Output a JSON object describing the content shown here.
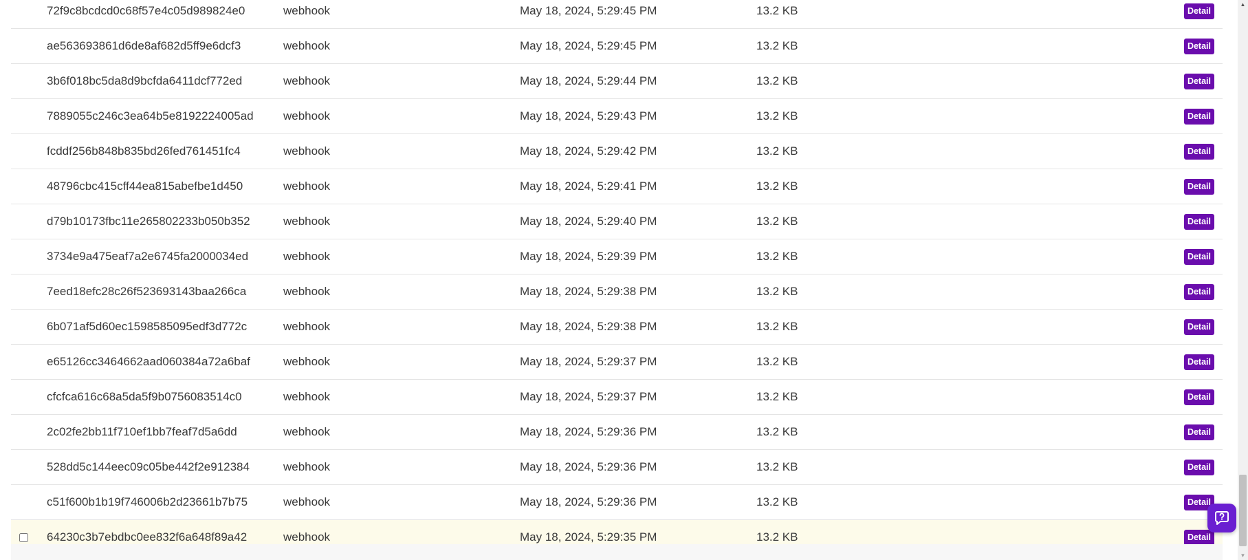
{
  "table": {
    "detail_label": "Detail",
    "rows": [
      {
        "id": "72f9c8bcdcd0c68f57e4c05d989824e0",
        "type": "webhook",
        "date": "May 18, 2024, 5:29:45 PM",
        "size": "13.2 KB"
      },
      {
        "id": "ae563693861d6de8af682d5ff9e6dcf3",
        "type": "webhook",
        "date": "May 18, 2024, 5:29:45 PM",
        "size": "13.2 KB"
      },
      {
        "id": "3b6f018bc5da8d9bcfda6411dcf772ed",
        "type": "webhook",
        "date": "May 18, 2024, 5:29:44 PM",
        "size": "13.2 KB"
      },
      {
        "id": "7889055c246c3ea64b5e8192224005ad",
        "type": "webhook",
        "date": "May 18, 2024, 5:29:43 PM",
        "size": "13.2 KB"
      },
      {
        "id": "fcddf256b848b835bd26fed761451fc4",
        "type": "webhook",
        "date": "May 18, 2024, 5:29:42 PM",
        "size": "13.2 KB"
      },
      {
        "id": "48796cbc415cff44ea815abefbe1d450",
        "type": "webhook",
        "date": "May 18, 2024, 5:29:41 PM",
        "size": "13.2 KB"
      },
      {
        "id": "d79b10173fbc11e265802233b050b352",
        "type": "webhook",
        "date": "May 18, 2024, 5:29:40 PM",
        "size": "13.2 KB"
      },
      {
        "id": "3734e9a475eaf7a2e6745fa2000034ed",
        "type": "webhook",
        "date": "May 18, 2024, 5:29:39 PM",
        "size": "13.2 KB"
      },
      {
        "id": "7eed18efc28c26f523693143baa266ca",
        "type": "webhook",
        "date": "May 18, 2024, 5:29:38 PM",
        "size": "13.2 KB"
      },
      {
        "id": "6b071af5d60ec1598585095edf3d772c",
        "type": "webhook",
        "date": "May 18, 2024, 5:29:38 PM",
        "size": "13.2 KB"
      },
      {
        "id": "e65126cc3464662aad060384a72a6baf",
        "type": "webhook",
        "date": "May 18, 2024, 5:29:37 PM",
        "size": "13.2 KB"
      },
      {
        "id": "cfcfca616c68a5da5f9b0756083514c0",
        "type": "webhook",
        "date": "May 18, 2024, 5:29:37 PM",
        "size": "13.2 KB"
      },
      {
        "id": "2c02fe2bb11f710ef1bb7feaf7d5a6dd",
        "type": "webhook",
        "date": "May 18, 2024, 5:29:36 PM",
        "size": "13.2 KB"
      },
      {
        "id": "528dd5c144eec09c05be442f2e912384",
        "type": "webhook",
        "date": "May 18, 2024, 5:29:36 PM",
        "size": "13.2 KB"
      },
      {
        "id": "c51f600b1b19f746006b2d23661b7b75",
        "type": "webhook",
        "date": "May 18, 2024, 5:29:36 PM",
        "size": "13.2 KB"
      },
      {
        "id": "64230c3b7ebdbc0ee832f6a648f89a42",
        "type": "webhook",
        "date": "May 18, 2024, 5:29:35 PM",
        "size": "13.2 KB",
        "hovered": true,
        "checkbox_visible": true,
        "checked": false
      }
    ]
  },
  "colors": {
    "accent": "#6a0dad",
    "row_highlight": "#fdfbea",
    "help_widget": "#6a1fd1"
  },
  "icons": {
    "help_widget": "chat-help-icon",
    "scroll_up": "arrow-up-icon",
    "scroll_down": "arrow-down-icon"
  }
}
